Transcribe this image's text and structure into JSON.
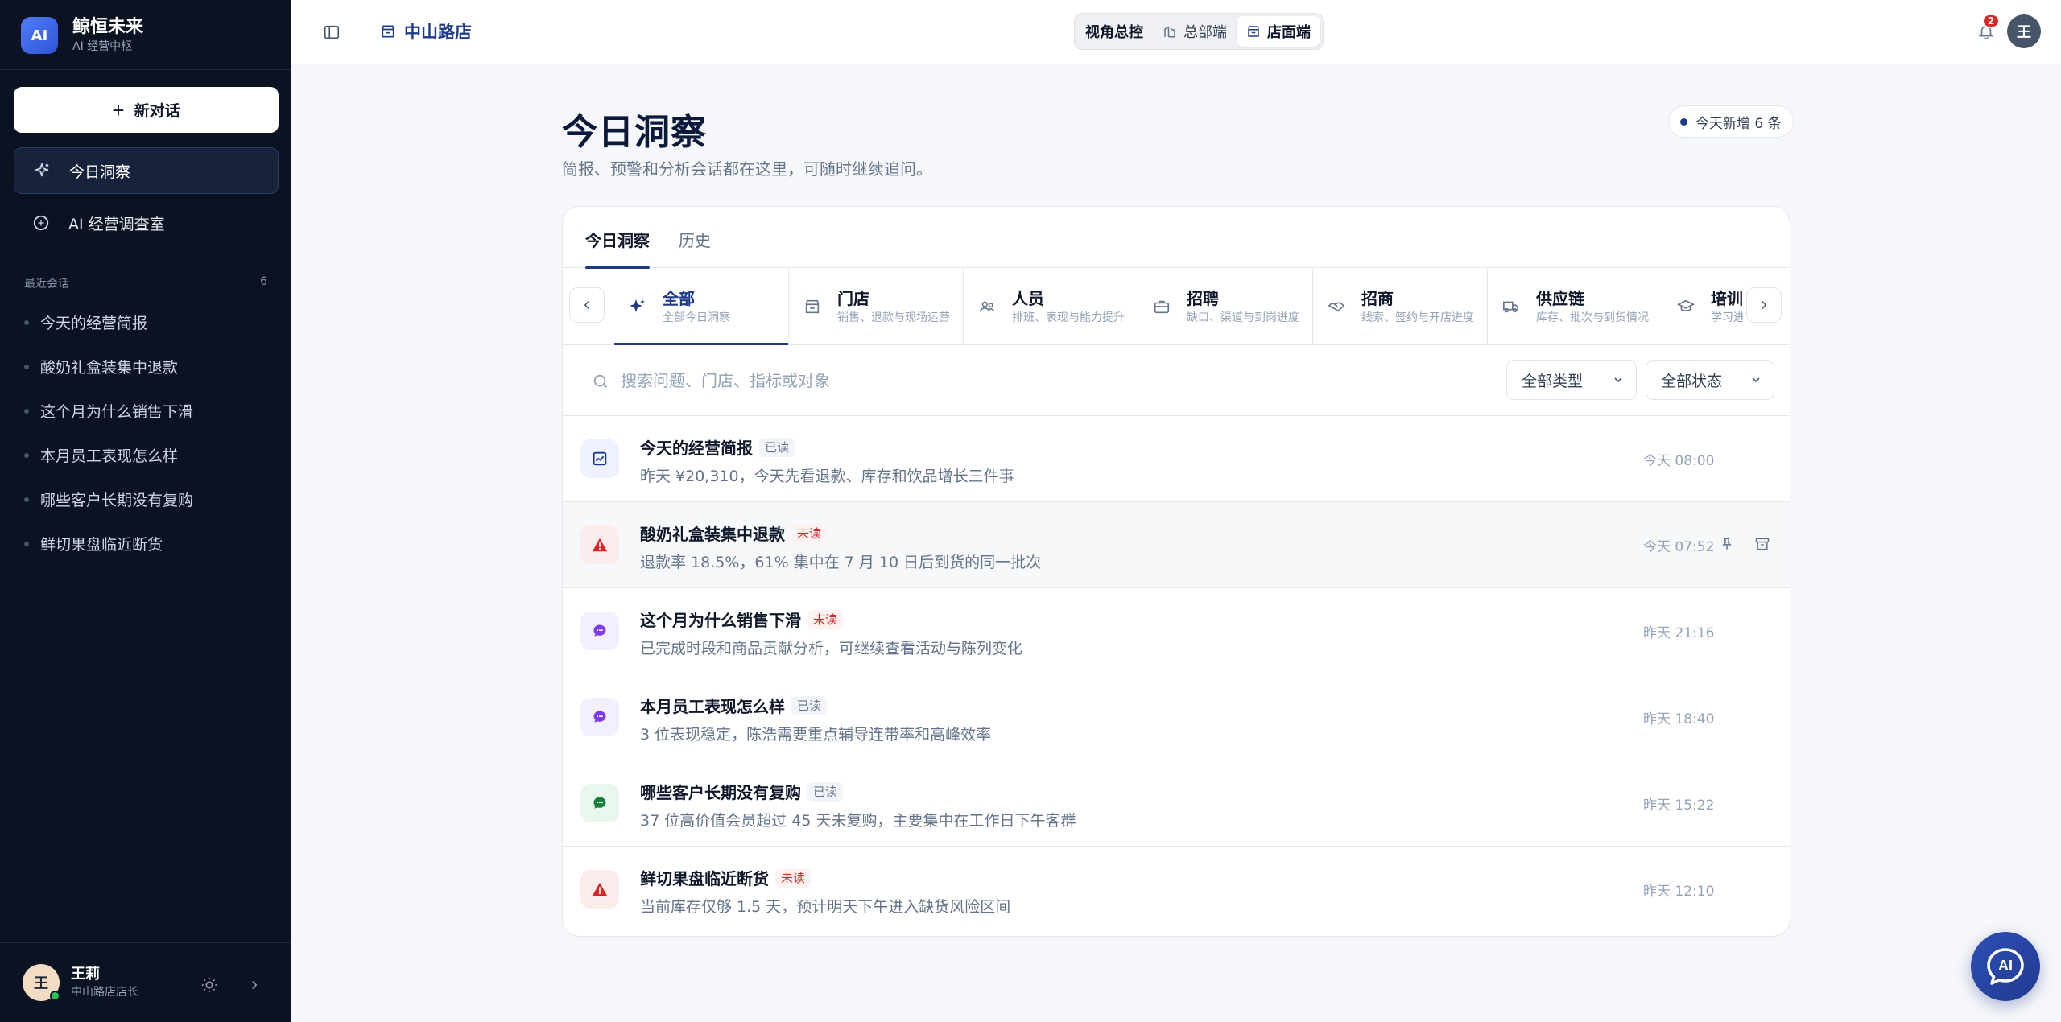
{
  "brand": {
    "name": "鲸恒未来",
    "sub": "AI 经营中枢",
    "logo": "AI"
  },
  "sidebar": {
    "new_chat": "新对话",
    "nav": [
      {
        "label": "今日洞察",
        "icon": "sparkle-icon",
        "active": true
      },
      {
        "label": "AI 经营调查室",
        "icon": "compass-icon",
        "active": false
      }
    ],
    "recent_title": "最近会话",
    "recent_count": "6",
    "recent": [
      "今天的经营简报",
      "酸奶礼盒装集中退款",
      "这个月为什么销售下滑",
      "本月员工表现怎么样",
      "哪些客户长期没有复购",
      "鲜切果盘临近断货"
    ]
  },
  "user": {
    "initial": "王",
    "name": "王莉",
    "role": "中山路店店长"
  },
  "topbar": {
    "store": "中山路店",
    "view_label": "视角总控",
    "views": [
      {
        "label": "总部端",
        "icon": "building-icon",
        "active": false
      },
      {
        "label": "店面端",
        "icon": "store-icon",
        "active": true
      }
    ],
    "notifications": "2",
    "avatar": "王"
  },
  "main": {
    "title": "今日洞察",
    "subtitle": "简报、预警和分析会话都在这里，可随时继续追问。",
    "badge": "今天新增 6 条",
    "tabs": [
      "今日洞察",
      "历史"
    ],
    "categories": [
      {
        "name": "全部",
        "desc": "全部今日洞察",
        "icon": "sparkle-icon",
        "active": true
      },
      {
        "name": "门店",
        "desc": "销售、退款与现场运营",
        "icon": "store-icon",
        "active": false
      },
      {
        "name": "人员",
        "desc": "排班、表现与能力提升",
        "icon": "users-icon",
        "active": false
      },
      {
        "name": "招聘",
        "desc": "缺口、渠道与到岗进度",
        "icon": "briefcase-icon",
        "active": false
      },
      {
        "name": "招商",
        "desc": "线索、签约与开店进度",
        "icon": "handshake-icon",
        "active": false
      },
      {
        "name": "供应链",
        "desc": "库存、批次与到货情况",
        "icon": "truck-icon",
        "active": false
      },
      {
        "name": "培训",
        "desc": "学习进度与认证",
        "icon": "graduation-cap-icon",
        "active": false
      }
    ],
    "search_placeholder": "搜索问题、门店、指标或对象",
    "filter_type": "全部类型",
    "filter_status": "全部状态",
    "items": [
      {
        "title": "今天的经营简报",
        "status": "已读",
        "read": true,
        "desc": "昨天 ¥20,310，今天先看退款、库存和饮品增长三件事",
        "time": "今天 08:00",
        "icon": "report-icon",
        "color": "#1e3a8a",
        "bg": "#eef2ff"
      },
      {
        "title": "酸奶礼盒装集中退款",
        "status": "未读",
        "read": false,
        "desc": "退款率 18.5%，61% 集中在 7 月 10 日后到货的同一批次",
        "time": "今天 07:52",
        "icon": "warning-icon",
        "color": "#dc2626",
        "bg": "#fdecec"
      },
      {
        "title": "这个月为什么销售下滑",
        "status": "未读",
        "read": false,
        "desc": "已完成时段和商品贡献分析，可继续查看活动与陈列变化",
        "time": "昨天 21:16",
        "icon": "chat-icon",
        "color": "#7c3aed",
        "bg": "#f3efff"
      },
      {
        "title": "本月员工表现怎么样",
        "status": "已读",
        "read": true,
        "desc": "3 位表现稳定，陈浩需要重点辅导连带率和高峰效率",
        "time": "昨天 18:40",
        "icon": "chat-icon",
        "color": "#7c3aed",
        "bg": "#f3efff"
      },
      {
        "title": "哪些客户长期没有复购",
        "status": "已读",
        "read": true,
        "desc": "37 位高价值会员超过 45 天未复购，主要集中在工作日下午客群",
        "time": "昨天 15:22",
        "icon": "chat-icon",
        "color": "#15803d",
        "bg": "#e9f7ee"
      },
      {
        "title": "鲜切果盘临近断货",
        "status": "未读",
        "read": false,
        "desc": "当前库存仅够 1.5 天，预计明天下午进入缺货风险区间",
        "time": "昨天 12:10",
        "icon": "warning-icon",
        "color": "#dc2626",
        "bg": "#fdecec"
      }
    ]
  },
  "fab_label": "AI"
}
